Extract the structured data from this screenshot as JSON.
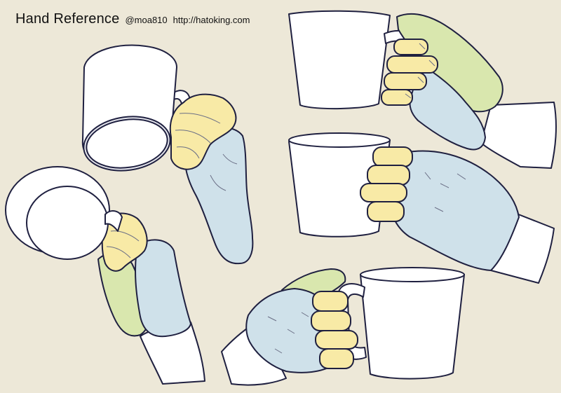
{
  "header": {
    "title": "Hand Reference",
    "handle": "@moa810",
    "url": "http://hatoking.com"
  },
  "colors": {
    "background": "#ede8d8",
    "fingers": "#f8eaa6",
    "thumb": "#d9e7ae",
    "palm": "#cfe1ea",
    "line": "#1f2040"
  }
}
